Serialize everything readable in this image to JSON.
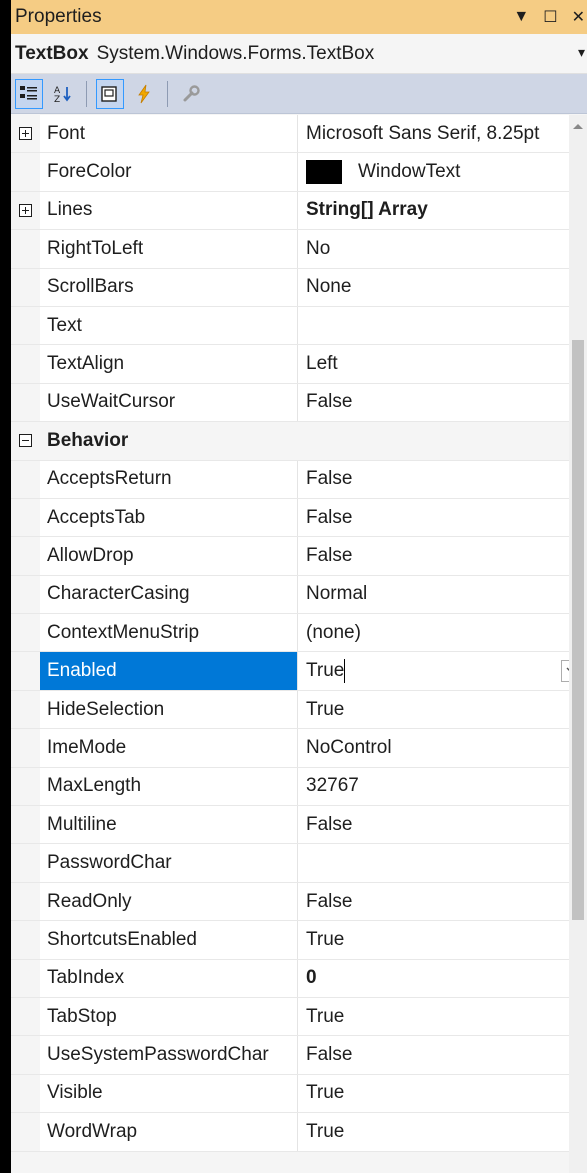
{
  "panel": {
    "title": "Properties",
    "title_controls": [
      "▼",
      "☐",
      "✕"
    ]
  },
  "object": {
    "name": "TextBox",
    "type": "System.Windows.Forms.TextBox"
  },
  "toolbar": {
    "buttons": [
      "categorized-icon",
      "alphabetical-icon",
      "properties-icon",
      "events-icon",
      "property-pages-icon"
    ]
  },
  "grid": {
    "rows": [
      {
        "kind": "prop",
        "expander": "plus",
        "name": "Font",
        "value": "Microsoft Sans Serif, 8.25pt"
      },
      {
        "kind": "prop",
        "name": "ForeColor",
        "value": "WindowText",
        "swatch": "#000000"
      },
      {
        "kind": "prop",
        "expander": "plus",
        "name": "Lines",
        "value": "String[] Array",
        "bold": true
      },
      {
        "kind": "prop",
        "name": "RightToLeft",
        "value": "No"
      },
      {
        "kind": "prop",
        "name": "ScrollBars",
        "value": "None"
      },
      {
        "kind": "prop",
        "name": "Text",
        "value": ""
      },
      {
        "kind": "prop",
        "name": "TextAlign",
        "value": "Left"
      },
      {
        "kind": "prop",
        "name": "UseWaitCursor",
        "value": "False"
      },
      {
        "kind": "category",
        "expander": "minus",
        "name": "Behavior",
        "value": ""
      },
      {
        "kind": "prop",
        "name": "AcceptsReturn",
        "value": "False"
      },
      {
        "kind": "prop",
        "name": "AcceptsTab",
        "value": "False"
      },
      {
        "kind": "prop",
        "name": "AllowDrop",
        "value": "False"
      },
      {
        "kind": "prop",
        "name": "CharacterCasing",
        "value": "Normal"
      },
      {
        "kind": "prop",
        "name": "ContextMenuStrip",
        "value": "(none)"
      },
      {
        "kind": "prop",
        "name": "Enabled",
        "value": "True",
        "selected": true
      },
      {
        "kind": "prop",
        "name": "HideSelection",
        "value": "True"
      },
      {
        "kind": "prop",
        "name": "ImeMode",
        "value": "NoControl"
      },
      {
        "kind": "prop",
        "name": "MaxLength",
        "value": "32767"
      },
      {
        "kind": "prop",
        "name": "Multiline",
        "value": "False"
      },
      {
        "kind": "prop",
        "name": "PasswordChar",
        "value": ""
      },
      {
        "kind": "prop",
        "name": "ReadOnly",
        "value": "False"
      },
      {
        "kind": "prop",
        "name": "ShortcutsEnabled",
        "value": "True"
      },
      {
        "kind": "prop",
        "name": "TabIndex",
        "value": "0",
        "bold": true
      },
      {
        "kind": "prop",
        "name": "TabStop",
        "value": "True"
      },
      {
        "kind": "prop",
        "name": "UseSystemPasswordChar",
        "value": "False"
      },
      {
        "kind": "prop",
        "name": "Visible",
        "value": "True"
      },
      {
        "kind": "prop",
        "name": "WordWrap",
        "value": "True"
      }
    ]
  },
  "colors": {
    "title_bar": "#f5cc84",
    "toolbar": "#cfd6e5",
    "selection": "#0078d7"
  }
}
